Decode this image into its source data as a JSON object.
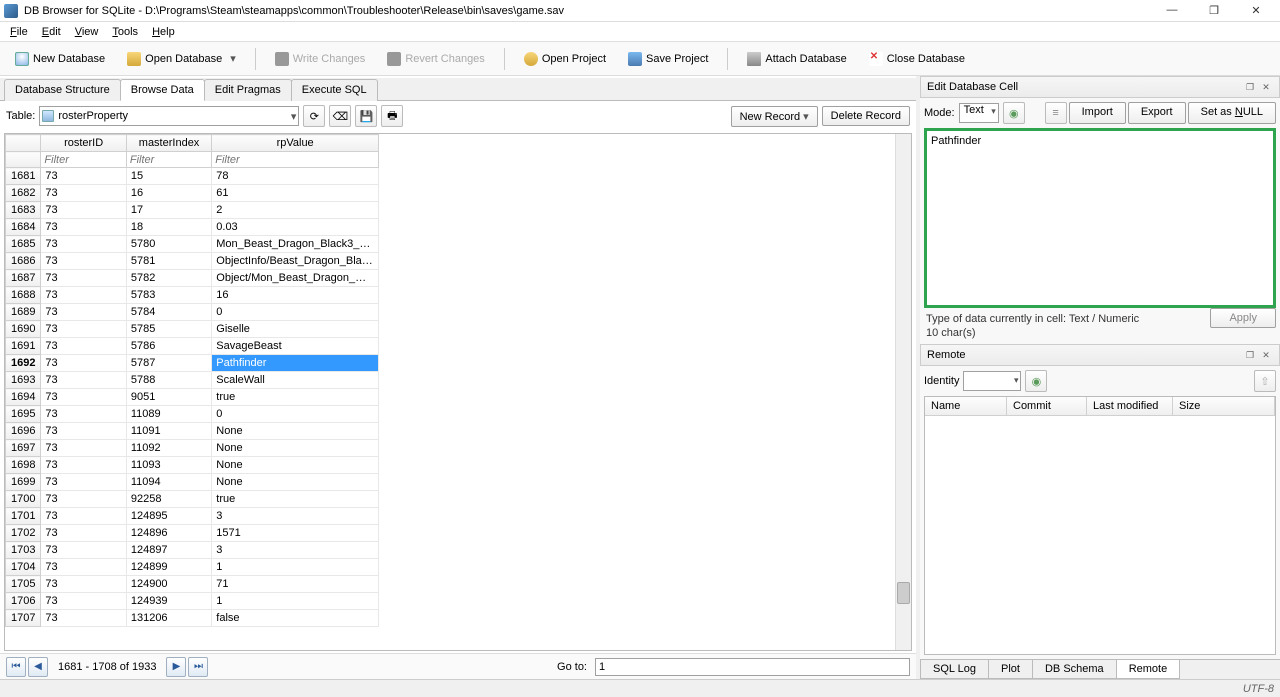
{
  "window": {
    "title": "DB Browser for SQLite - D:\\Programs\\Steam\\steamapps\\common\\Troubleshooter\\Release\\bin\\saves\\game.sav",
    "minimize": "—",
    "maximize": "❐",
    "close": "✕"
  },
  "menu": {
    "file": "File",
    "edit": "Edit",
    "view": "View",
    "tools": "Tools",
    "help": "Help"
  },
  "toolbar": {
    "new_database": "New Database",
    "open_database": "Open Database",
    "write_changes": "Write Changes",
    "revert_changes": "Revert Changes",
    "open_project": "Open Project",
    "save_project": "Save Project",
    "attach_database": "Attach Database",
    "close_database": "Close Database"
  },
  "main_tabs": {
    "structure": "Database Structure",
    "browse": "Browse Data",
    "pragmas": "Edit Pragmas",
    "sql": "Execute SQL"
  },
  "browse": {
    "table_label": "Table:",
    "table_name": "rosterProperty",
    "new_record": "New Record",
    "delete_record": "Delete Record",
    "refresh_icon": "⟳",
    "clear_icon": "⌫",
    "save_icon": "💾",
    "print_icon": "🖶"
  },
  "columns": {
    "rownum": "",
    "c1": "rosterID",
    "c2": "masterIndex",
    "c3": "rpValue"
  },
  "filter_placeholder": "Filter",
  "rows": [
    {
      "n": "1681",
      "a": "73",
      "b": "15",
      "c": "78"
    },
    {
      "n": "1682",
      "a": "73",
      "b": "16",
      "c": "61"
    },
    {
      "n": "1683",
      "a": "73",
      "b": "17",
      "c": "2"
    },
    {
      "n": "1684",
      "a": "73",
      "b": "18",
      "c": "0.03"
    },
    {
      "n": "1685",
      "a": "73",
      "b": "5780",
      "c": "Mon_Beast_Dragon_Black3_…"
    },
    {
      "n": "1686",
      "a": "73",
      "b": "5781",
      "c": "ObjectInfo/Beast_Dragon_Bla…"
    },
    {
      "n": "1687",
      "a": "73",
      "b": "5782",
      "c": "Object/Mon_Beast_Dragon_…"
    },
    {
      "n": "1688",
      "a": "73",
      "b": "5783",
      "c": "16"
    },
    {
      "n": "1689",
      "a": "73",
      "b": "5784",
      "c": "0"
    },
    {
      "n": "1690",
      "a": "73",
      "b": "5785",
      "c": "Giselle"
    },
    {
      "n": "1691",
      "a": "73",
      "b": "5786",
      "c": "SavageBeast"
    },
    {
      "n": "1692",
      "a": "73",
      "b": "5787",
      "c": "Pathfinder",
      "sel": true
    },
    {
      "n": "1693",
      "a": "73",
      "b": "5788",
      "c": "ScaleWall"
    },
    {
      "n": "1694",
      "a": "73",
      "b": "9051",
      "c": "true"
    },
    {
      "n": "1695",
      "a": "73",
      "b": "11089",
      "c": "0"
    },
    {
      "n": "1696",
      "a": "73",
      "b": "11091",
      "c": "None"
    },
    {
      "n": "1697",
      "a": "73",
      "b": "11092",
      "c": "None"
    },
    {
      "n": "1698",
      "a": "73",
      "b": "11093",
      "c": "None"
    },
    {
      "n": "1699",
      "a": "73",
      "b": "11094",
      "c": "None"
    },
    {
      "n": "1700",
      "a": "73",
      "b": "92258",
      "c": "true"
    },
    {
      "n": "1701",
      "a": "73",
      "b": "124895",
      "c": "3"
    },
    {
      "n": "1702",
      "a": "73",
      "b": "124896",
      "c": "1571"
    },
    {
      "n": "1703",
      "a": "73",
      "b": "124897",
      "c": "3"
    },
    {
      "n": "1704",
      "a": "73",
      "b": "124899",
      "c": "1"
    },
    {
      "n": "1705",
      "a": "73",
      "b": "124900",
      "c": "71"
    },
    {
      "n": "1706",
      "a": "73",
      "b": "124939",
      "c": "1"
    },
    {
      "n": "1707",
      "a": "73",
      "b": "131206",
      "c": "false"
    }
  ],
  "nav": {
    "first": "⏮",
    "prev": "◀",
    "info": "1681 - 1708 of 1933",
    "next": "▶",
    "last": "⏭",
    "goto": "Go to:",
    "goto_value": "1"
  },
  "edit_cell": {
    "panel_title": "Edit Database Cell",
    "mode_label": "Mode:",
    "mode_value": "Text",
    "import": "Import",
    "export": "Export",
    "set_null": "Set as NULL",
    "value": "Pathfinder",
    "type_info": "Type of data currently in cell: Text / Numeric",
    "chars": "10 char(s)",
    "apply": "Apply"
  },
  "remote": {
    "panel_title": "Remote",
    "identity_label": "Identity",
    "col_name": "Name",
    "col_commit": "Commit",
    "col_modified": "Last modified",
    "col_size": "Size"
  },
  "bottom_tabs": {
    "sql_log": "SQL Log",
    "plot": "Plot",
    "db_schema": "DB Schema",
    "remote": "Remote"
  },
  "status": {
    "encoding": "UTF-8"
  }
}
